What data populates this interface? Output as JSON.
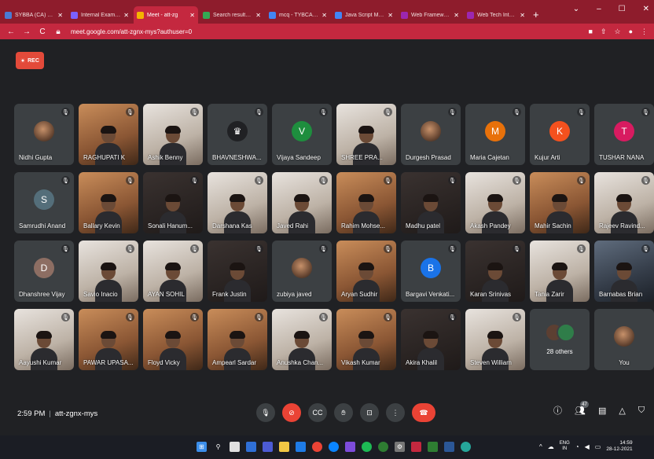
{
  "browser": {
    "tabs": [
      {
        "title": "SYBBA (CA) 2021",
        "color": "#4a7bd4",
        "active": false
      },
      {
        "title": "Internal Exam Sl",
        "color": "#7b61ff",
        "active": false
      },
      {
        "title": "Meet - att-zg",
        "color": "#f4b400",
        "active": true
      },
      {
        "title": "Search results - G",
        "color": "#34a853",
        "active": false
      },
      {
        "title": "mcq - TYBCA.do",
        "color": "#4285f4",
        "active": false
      },
      {
        "title": "Java Script MCQ",
        "color": "#4285f4",
        "active": false
      },
      {
        "title": "Web Framework",
        "color": "#9c27b0",
        "active": false
      },
      {
        "title": "Web Tech Intern",
        "color": "#9c27b0",
        "active": false
      }
    ],
    "new_tab": "+",
    "url": "meet.google.com/att-zgnx-mys?authuser=0"
  },
  "meet": {
    "rec_label": "REC",
    "participants": [
      {
        "name": "Nidhi Gupta",
        "kind": "photo-avatar"
      },
      {
        "name": "RAGHUPATI K",
        "kind": "video",
        "tone": "warm"
      },
      {
        "name": "Ashik Benny",
        "kind": "video",
        "tone": "light"
      },
      {
        "name": "BHAVNESHWA...",
        "kind": "avatar",
        "letter": "♛",
        "color": "#202124"
      },
      {
        "name": "Vijaya Sandeep",
        "kind": "avatar",
        "letter": "V",
        "color": "#1e8e3e"
      },
      {
        "name": "SHREE PRA...",
        "kind": "video",
        "tone": "light"
      },
      {
        "name": "Durgesh Prasad",
        "kind": "photo-avatar"
      },
      {
        "name": "Maria Cajetan",
        "kind": "avatar",
        "letter": "M",
        "color": "#e8710a"
      },
      {
        "name": "Kujur Arti",
        "kind": "avatar",
        "letter": "K",
        "color": "#f4511e"
      },
      {
        "name": "TUSHAR NANA",
        "kind": "avatar",
        "letter": "T",
        "color": "#d81b60"
      },
      {
        "name": "Samrudhi Anand",
        "kind": "avatar",
        "letter": "S",
        "color": "#546e7a"
      },
      {
        "name": "Ballary Kevin",
        "kind": "video",
        "tone": "warm"
      },
      {
        "name": "Sonali Hanum...",
        "kind": "video",
        "tone": "dark"
      },
      {
        "name": "Darshana Kas",
        "kind": "video",
        "tone": "light"
      },
      {
        "name": "Javed Rahi",
        "kind": "video",
        "tone": "light"
      },
      {
        "name": "Rahim Mohse...",
        "kind": "video",
        "tone": "warm"
      },
      {
        "name": "Madhu patel",
        "kind": "video",
        "tone": "dark"
      },
      {
        "name": "Akash Pandey",
        "kind": "video",
        "tone": "light"
      },
      {
        "name": "Mahir Sachin",
        "kind": "video",
        "tone": "warm"
      },
      {
        "name": "Rajeev Ravind...",
        "kind": "video",
        "tone": "light"
      },
      {
        "name": "Dhanshree Vijay",
        "kind": "avatar",
        "letter": "D",
        "color": "#8d6e63"
      },
      {
        "name": "Savio Inacio",
        "kind": "video",
        "tone": "light"
      },
      {
        "name": "AYAN SOHIL",
        "kind": "video",
        "tone": "light"
      },
      {
        "name": "Frank Justin",
        "kind": "video",
        "tone": "dark"
      },
      {
        "name": "zubiya javed",
        "kind": "photo-avatar"
      },
      {
        "name": "Aryan Sudhir",
        "kind": "video",
        "tone": "warm"
      },
      {
        "name": "Bargavi Venkati...",
        "kind": "avatar",
        "letter": "B",
        "color": "#1a73e8"
      },
      {
        "name": "Karan Srinivas",
        "kind": "video",
        "tone": "dark"
      },
      {
        "name": "Tania Zarir",
        "kind": "video",
        "tone": "light"
      },
      {
        "name": "Barnabas Brian",
        "kind": "video",
        "tone": "blue"
      },
      {
        "name": "Aayushi Kumar",
        "kind": "video",
        "tone": "light"
      },
      {
        "name": "PAWAR UPASA...",
        "kind": "video",
        "tone": "warm"
      },
      {
        "name": "Floyd Vicky",
        "kind": "video",
        "tone": "warm"
      },
      {
        "name": "Ampearl Sardar",
        "kind": "video",
        "tone": "warm"
      },
      {
        "name": "Anushka Chan...",
        "kind": "video",
        "tone": "light"
      },
      {
        "name": "Vikash Kumar",
        "kind": "video",
        "tone": "warm"
      },
      {
        "name": "Akira Khalil",
        "kind": "video",
        "tone": "dark"
      },
      {
        "name": "Steven William",
        "kind": "video",
        "tone": "light"
      },
      {
        "name": "28 others",
        "kind": "others"
      },
      {
        "name": "You",
        "kind": "photo-avatar"
      }
    ],
    "time": "2:59 PM",
    "meeting_code": "att-zgnx-mys",
    "people_count": "47"
  },
  "taskbar": {
    "lang_top": "ENG",
    "lang_bottom": "IN",
    "clock_time": "14:59",
    "clock_date": "28-12-2021"
  }
}
